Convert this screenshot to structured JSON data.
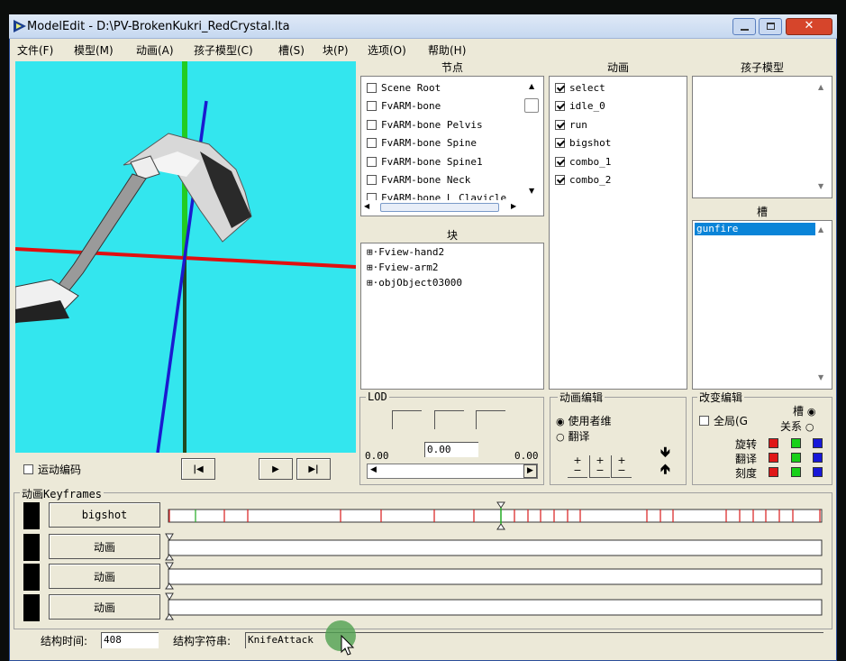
{
  "window": {
    "title": "ModelEdit - D:\\PV-BrokenKukri_RedCrystal.lta"
  },
  "menu": [
    "文件(F)",
    "模型(M)",
    "动画(A)",
    "孩子模型(C)",
    "槽(S)",
    "块(P)",
    "选项(O)",
    "帮助(H)"
  ],
  "nodes": {
    "header": "节点",
    "items": [
      "Scene Root",
      "FvARM-bone",
      "FvARM-bone Pelvis",
      "FvARM-bone Spine",
      "FvARM-bone Spine1",
      "FvARM-bone Neck",
      "FvARM-bone L Clavicle"
    ]
  },
  "animations": {
    "header": "动画",
    "items": [
      "select",
      "idle_0",
      "run",
      "bigshot",
      "combo_1",
      "combo_2"
    ]
  },
  "child_models": {
    "header": "孩子模型"
  },
  "slots": {
    "header": "槽",
    "items": [
      "gunfire"
    ]
  },
  "blocks": {
    "header": "块",
    "items": [
      "Fview-hand2",
      "Fview-arm2",
      "objObject03000"
    ]
  },
  "lod": {
    "label": "LOD",
    "min": "0.00",
    "value": "0.00",
    "max": "0.00"
  },
  "anim_edit": {
    "label": "动画编辑",
    "option_user_dim": "使用者维",
    "option_translate": "翻译",
    "plus": "+",
    "minus": "−"
  },
  "change_edit": {
    "label": "改变编辑",
    "global": "全局(G",
    "slot": "槽",
    "relation": "关系",
    "rotate": "旋转",
    "translate": "翻译",
    "scale": "刻度"
  },
  "motion_encode": {
    "label": "运动编码"
  },
  "keyframes": {
    "label": "动画Keyframes",
    "rows": [
      {
        "label": "bigshot"
      },
      {
        "label": "动画"
      },
      {
        "label": "动画"
      },
      {
        "label": "动画"
      }
    ]
  },
  "footer": {
    "struct_time_label": "结构时间:",
    "struct_time_value": "408",
    "struct_string_label": "结构字符串:",
    "struct_string_value": "KnifeAttack"
  },
  "colors": {
    "viewport": "#33e6ee",
    "axis_x": "#e01010",
    "axis_y": "#22cc22",
    "axis_z": "#1a1ad0",
    "selection": "#0a84d8"
  }
}
